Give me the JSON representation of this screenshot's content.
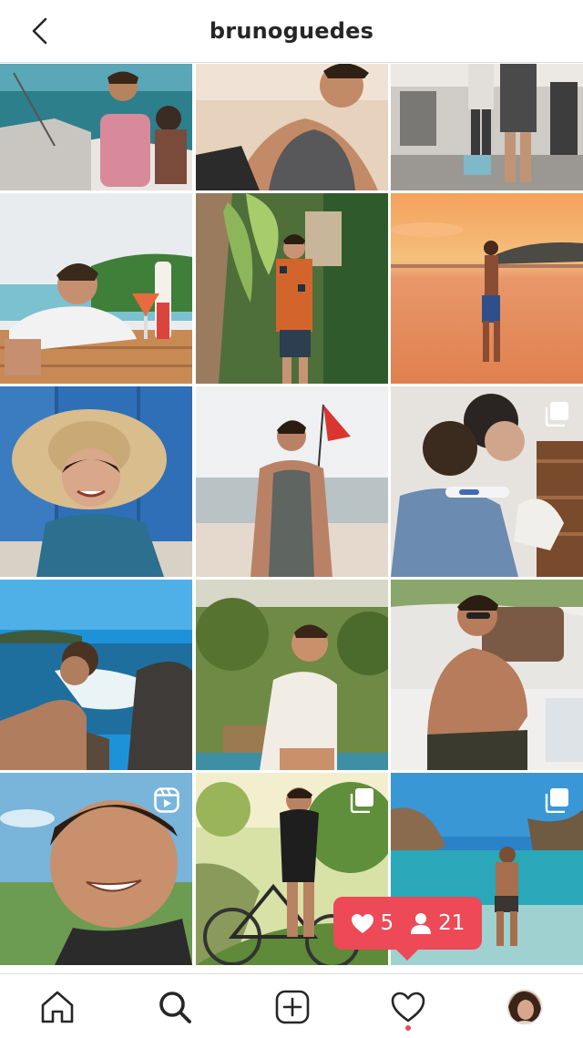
{
  "header": {
    "title": "brunoguedes",
    "back_icon": "chevron-left-icon"
  },
  "colors": {
    "accent": "#ed4956",
    "divider": "#dbdbdb",
    "text": "#262626"
  },
  "grid": {
    "posts": [
      {
        "scene": "boat-ocean"
      },
      {
        "scene": "beach-tanktop-smile"
      },
      {
        "scene": "gym"
      },
      {
        "scene": "pool-drink"
      },
      {
        "scene": "tropical-plants"
      },
      {
        "scene": "sunset-beach"
      },
      {
        "scene": "child-straw-hat"
      },
      {
        "scene": "beach-flag"
      },
      {
        "scene": "pregnancy-test",
        "badge": "multiple-icon"
      },
      {
        "scene": "rocky-coast-selfie"
      },
      {
        "scene": "garden-look-up"
      },
      {
        "scene": "boat-sunglasses"
      },
      {
        "scene": "smile-selfie",
        "badge": "reels-icon"
      },
      {
        "scene": "bicycle",
        "badge": "multiple-icon"
      },
      {
        "scene": "lagoon-walk",
        "badge": "multiple-icon"
      }
    ]
  },
  "activity": {
    "likes": "5",
    "follows": "21"
  },
  "tabbar": {
    "items": [
      {
        "name": "home-icon"
      },
      {
        "name": "search-icon"
      },
      {
        "name": "new-post-icon"
      },
      {
        "name": "heart-icon"
      },
      {
        "name": "profile-avatar"
      }
    ]
  }
}
